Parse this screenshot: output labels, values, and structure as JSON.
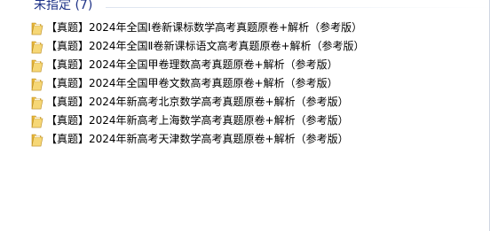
{
  "group": {
    "title": "未指定 (7)",
    "accent": "#1e3287"
  },
  "items": [
    {
      "name": "【真题】2024年全国Ⅰ卷新课标数学高考真题原卷+解析（参考版）",
      "icon": "folder-icon"
    },
    {
      "name": "【真题】2024年全国Ⅱ卷新课标语文高考真题原卷+解析（参考版）",
      "icon": "folder-icon"
    },
    {
      "name": "【真题】2024年全国甲卷理数高考真题原卷+解析（参考版）",
      "icon": "folder-icon"
    },
    {
      "name": "【真题】2024年全国甲卷文数高考真题原卷+解析（参考版）",
      "icon": "folder-icon"
    },
    {
      "name": "【真题】2024年新高考北京数学高考真题原卷+解析（参考版）",
      "icon": "folder-icon"
    },
    {
      "name": "【真题】2024年新高考上海数学高考真题原卷+解析（参考版）",
      "icon": "folder-icon"
    },
    {
      "name": "【真题】2024年新高考天津数学高考真题原卷+解析（参考版）",
      "icon": "folder-icon"
    }
  ],
  "colors": {
    "folder_body": "#e9b83a",
    "folder_front": "#f6d776",
    "folder_edge": "#b98a1f"
  }
}
